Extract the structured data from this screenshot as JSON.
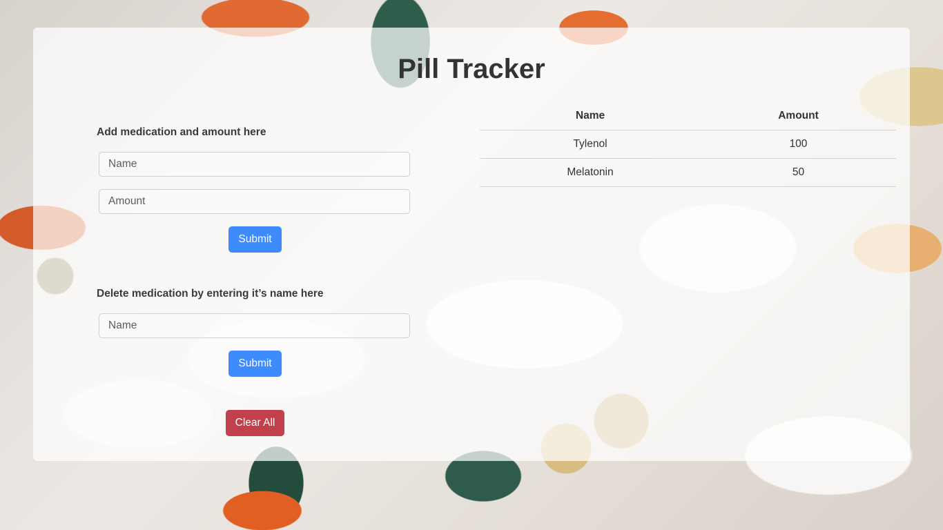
{
  "app": {
    "title": "Pill Tracker"
  },
  "add_form": {
    "label": "Add medication and amount here",
    "name_placeholder": "Name",
    "amount_placeholder": "Amount",
    "submit_label": "Submit"
  },
  "delete_form": {
    "label": "Delete medication by entering it’s name here",
    "name_placeholder": "Name",
    "submit_label": "Submit"
  },
  "clear_all_label": "Clear All",
  "table": {
    "headers": [
      "Name",
      "Amount"
    ],
    "rows": [
      {
        "name": "Tylenol",
        "amount": "100"
      },
      {
        "name": "Melatonin",
        "amount": "50"
      }
    ]
  },
  "colors": {
    "primary": "#3d8bfd",
    "danger": "#c1404b"
  }
}
